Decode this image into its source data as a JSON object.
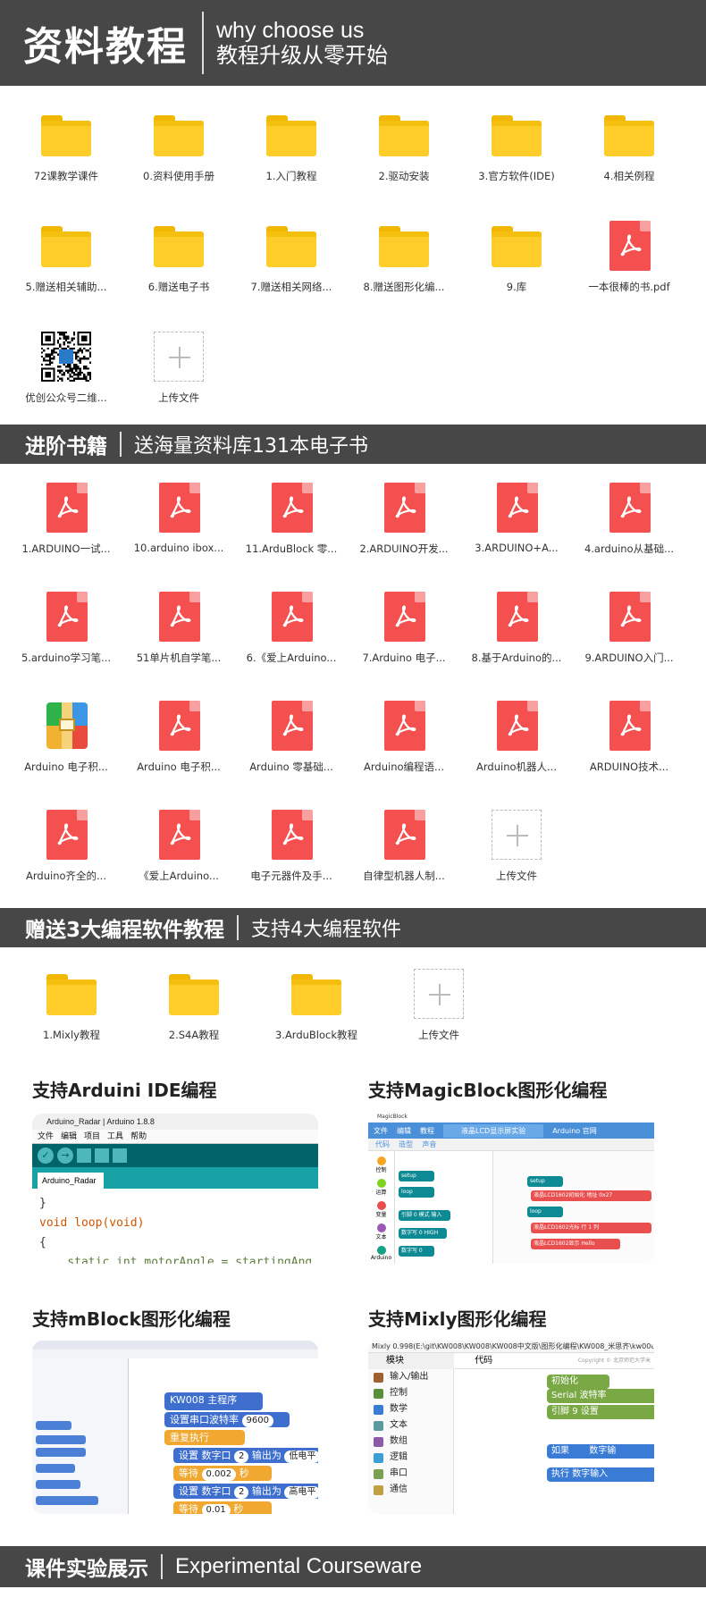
{
  "header": {
    "title": "资料教程",
    "subtitle_en": "why choose us",
    "subtitle_cn": "教程升级从零开始"
  },
  "section1": {
    "items": [
      {
        "name": "72课教学课件",
        "type": "folder"
      },
      {
        "name": "0.资料使用手册",
        "type": "folder"
      },
      {
        "name": "1.入门教程",
        "type": "folder"
      },
      {
        "name": "2.驱动安装",
        "type": "folder"
      },
      {
        "name": "3.官方软件(IDE)",
        "type": "folder"
      },
      {
        "name": "4.相关例程",
        "type": "folder"
      },
      {
        "name": "5.赠送相关辅助...",
        "type": "folder"
      },
      {
        "name": "6.赠送电子书",
        "type": "folder"
      },
      {
        "name": "7.赠送相关网络...",
        "type": "folder"
      },
      {
        "name": "8.赠送图形化编...",
        "type": "folder"
      },
      {
        "name": "9.库",
        "type": "folder"
      },
      {
        "name": "一本很棒的书.pdf",
        "type": "pdf"
      },
      {
        "name": "优创公众号二维...",
        "type": "qr"
      },
      {
        "name": "上传文件",
        "type": "upload"
      }
    ]
  },
  "banner2": {
    "left": "进阶书籍",
    "right": "送海量资料库131本电子书"
  },
  "section2": {
    "items": [
      {
        "name": "1.ARDUINO一试...",
        "type": "pdf"
      },
      {
        "name": "10.arduino ibox...",
        "type": "pdf"
      },
      {
        "name": "11.ArduBlock 零...",
        "type": "pdf"
      },
      {
        "name": "2.ARDUINO开发...",
        "type": "pdf"
      },
      {
        "name": "3.ARDUINO+A...",
        "type": "pdf"
      },
      {
        "name": "4.arduino从基础...",
        "type": "pdf"
      },
      {
        "name": "5.arduino学习笔...",
        "type": "pdf"
      },
      {
        "name": "51单片机自学笔...",
        "type": "pdf"
      },
      {
        "name": "6.《爱上Arduino...",
        "type": "pdf"
      },
      {
        "name": "7.Arduino 电子...",
        "type": "pdf"
      },
      {
        "name": "8.基于Arduino的...",
        "type": "pdf"
      },
      {
        "name": "9.ARDUINO入门...",
        "type": "pdf"
      },
      {
        "name": "Arduino 电子积...",
        "type": "archive"
      },
      {
        "name": "Arduino 电子积...",
        "type": "pdf"
      },
      {
        "name": "Arduino 零基础...",
        "type": "pdf"
      },
      {
        "name": "Arduino编程语...",
        "type": "pdf"
      },
      {
        "name": "Arduino机器人...",
        "type": "pdf"
      },
      {
        "name": "ARDUINO技术...",
        "type": "pdf"
      },
      {
        "name": "Arduino齐全的...",
        "type": "pdf"
      },
      {
        "name": "《爱上Arduino...",
        "type": "pdf"
      },
      {
        "name": "电子元器件及手...",
        "type": "pdf"
      },
      {
        "name": "自律型机器人制...",
        "type": "pdf"
      },
      {
        "name": "上传文件",
        "type": "upload"
      }
    ]
  },
  "banner3": {
    "left": "赠送3大编程软件教程",
    "right": "支持4大编程软件"
  },
  "section3": {
    "items": [
      {
        "name": "1.Mixly教程",
        "type": "folder"
      },
      {
        "name": "2.S4A教程",
        "type": "folder"
      },
      {
        "name": "3.ArduBlock教程",
        "type": "folder"
      },
      {
        "name": "上传文件",
        "type": "upload"
      }
    ]
  },
  "software": {
    "ide": {
      "title": "支持Arduini IDE编程",
      "window_title": "Arduino_Radar | Arduino 1.8.8",
      "menu": [
        "文件",
        "编辑",
        "项目",
        "工具",
        "帮助"
      ],
      "tab": "Arduino_Radar",
      "code": [
        "}",
        "void loop(void)",
        "{",
        "    static int motorAngle = startingAng"
      ]
    },
    "magicblock": {
      "title": "支持MagicBlock图形化编程",
      "window_title": "MagicBlock",
      "top_items": [
        "文件",
        "编辑",
        "教程"
      ],
      "project": "液晶LCD显示屏实验",
      "board": "Arduino 官网",
      "tabs": [
        "代码",
        "造型",
        "声音"
      ],
      "categories": [
        "控制",
        "运算",
        "变量",
        "文本",
        "Arduino",
        "串口"
      ],
      "blocks": [
        "setup",
        "loop",
        "引脚 0 模式 输入",
        "数字写 0 HIGH",
        "数字写 0"
      ],
      "canvas_blocks": [
        "setup",
        "液晶LCD1602初始化 地址 0x27",
        "loop",
        "液晶LCD1602光标 行 1 列",
        "液晶LCD1602显示 Hello"
      ]
    },
    "mblock": {
      "title": "支持mBlock图形化编程",
      "blocks": [
        "KW008 主程序",
        "设置串口波特率",
        "9600",
        "重复执行",
        "设置 数字口",
        "2",
        "输出为",
        "低电平",
        "等待",
        "0.002",
        "秒",
        "高电平",
        "0.01"
      ]
    },
    "mixly": {
      "title": "支持Mixly图形化编程",
      "window_title": "Mixly 0.998(E:\\git\\KW008\\KW008\\KW008中文版\\图形化编程\\KW008_米思齐\\kw008_mixly-",
      "tabs": [
        "模块",
        "代码"
      ],
      "copyright": "Copyright © 北京师范大学米",
      "categories": [
        "输入/输出",
        "控制",
        "数学",
        "文本",
        "数组",
        "逻辑",
        "串口",
        "通信"
      ],
      "blocks": [
        "初始化",
        "Serial",
        "波特率",
        "引脚",
        "9",
        "设置",
        "如果",
        "数字输",
        "执行",
        "数字输入"
      ]
    }
  },
  "footer": {
    "left": "课件实验展示",
    "right": "Experimental Courseware"
  },
  "colors": {
    "banner": "#474747",
    "folder": "#ffcd29",
    "pdf": "#f45050",
    "upload_border": "#bbbbbb"
  }
}
